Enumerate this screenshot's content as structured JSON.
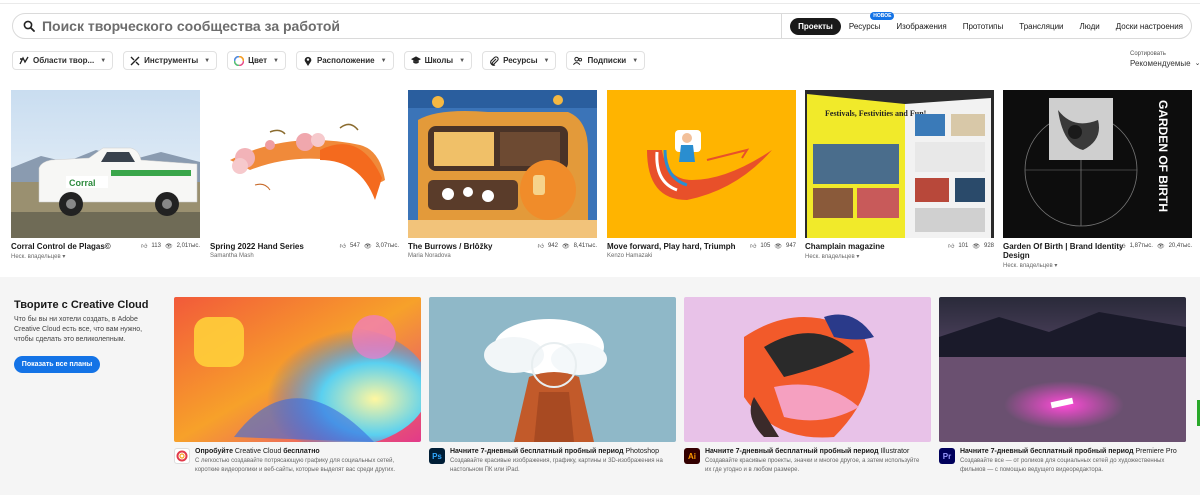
{
  "search": {
    "placeholder": "Поиск творческого сообщества за работой"
  },
  "scope_tabs": [
    {
      "label": "Проекты",
      "active": true
    },
    {
      "label": "Ресурсы",
      "badge": "НОВОЕ"
    },
    {
      "label": "Изображения"
    },
    {
      "label": "Прототипы"
    },
    {
      "label": "Трансляции"
    },
    {
      "label": "Люди"
    },
    {
      "label": "Доски настроения"
    }
  ],
  "filters": [
    {
      "label": "Области твор...",
      "icon": "fields-icon"
    },
    {
      "label": "Инструменты",
      "icon": "tools-icon"
    },
    {
      "label": "Цвет",
      "icon": "color-wheel-icon"
    },
    {
      "label": "Расположение",
      "icon": "location-pin-icon"
    },
    {
      "label": "Школы",
      "icon": "graduation-cap-icon"
    },
    {
      "label": "Ресурсы",
      "icon": "paperclip-icon"
    },
    {
      "label": "Подписки",
      "icon": "people-icon"
    }
  ],
  "sort": {
    "label": "Сортировать",
    "value": "Рекомендуемые"
  },
  "projects": [
    {
      "title": "Corral Control de Plagas©",
      "owner": "Неск. владельцев",
      "likes": "113",
      "views": "2,01тыс."
    },
    {
      "title": "Spring 2022 Hand Series",
      "owner": "Samantha Mash",
      "likes": "547",
      "views": "3,07тыс."
    },
    {
      "title": "The Burrows / Brlôžky",
      "owner": "Maria Noradova",
      "likes": "942",
      "views": "8,41тыс."
    },
    {
      "title": "Move forward, Play hard, Triumph",
      "owner": "Kenzo Hamazaki",
      "likes": "105",
      "views": "947"
    },
    {
      "title": "Champlain magazine",
      "owner": "Неск. владельцев",
      "likes": "101",
      "views": "928"
    },
    {
      "title": "Garden Of Birth | Brand Identity Design",
      "owner": "Неск. владельцев",
      "likes": "1,87тыс.",
      "views": "20,4тыс."
    }
  ],
  "project_art": {
    "truck_logo": "Corral",
    "magazine_headline": "Festivals, Festivities and Fun!",
    "garden_text": "GARDEN OF BIRTH"
  },
  "cc": {
    "title": "Творите с Creative Cloud",
    "desc": "Что бы вы ни хотели создать, в Adobe Creative Cloud есть все, что вам нужно, чтобы сделать это великолепным.",
    "button": "Показать все планы"
  },
  "offers": [
    {
      "title_bold": "Опробуйте",
      "title_normal": " Creative Cloud ",
      "title_bold2": "бесплатно",
      "desc": "С легкостью создавайте потрясающую графику для социальных сетей, короткие видеоролики и веб-сайты, которые выделят вас среди других.",
      "icon": "cc-icon",
      "icon_label": ""
    },
    {
      "title_bold": "Начните 7-дневный бесплатный пробный период",
      "title_normal": " Photoshop",
      "title_bold2": "",
      "desc": "Создавайте красивые изображения, графику, картины и 3D-изображения на настольном ПК или iPad.",
      "icon": "photoshop-icon",
      "icon_label": "Ps"
    },
    {
      "title_bold": "Начните 7-дневный бесплатный пробный период",
      "title_normal": " Illustrator",
      "title_bold2": "",
      "desc": "Создавайте красивые проекты, значки и многое другое, а затем используйте их где угодно и в любом размере.",
      "icon": "illustrator-icon",
      "icon_label": "Ai"
    },
    {
      "title_bold": "Начните 7-дневный бесплатный пробный период",
      "title_normal": " Premiere Pro",
      "title_bold2": "",
      "desc": "Создавайте все — от роликов для социальных сетей до художественных фильмов — с помощью ведущего видеоредактора.",
      "icon": "premiere-icon",
      "icon_label": "Pr"
    }
  ],
  "colors": {
    "accent": "#1473e6",
    "dark": "#191919"
  }
}
